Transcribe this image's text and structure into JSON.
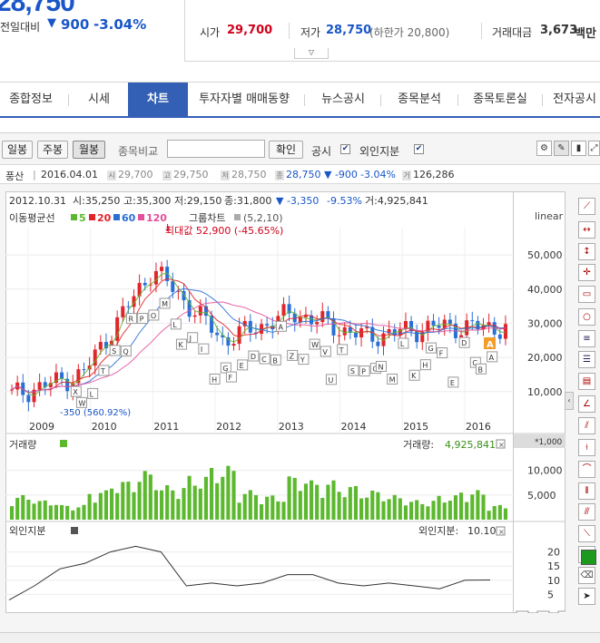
{
  "quote": {
    "price": "28,750",
    "prev_label": "전일대비",
    "prev_arrow": "▼",
    "prev_change": "900",
    "prev_pct": "-3.04%",
    "open_label": "시가",
    "open_value": "29,700",
    "low_label": "저가",
    "low_value": "28,750",
    "low_note": "(하한가 20,800)",
    "amount_label": "거래대금",
    "amount_value": "3,673",
    "amount_unit": "백만",
    "expand_icon": "chevron-down-icon"
  },
  "tabs": [
    {
      "label": "종합정보"
    },
    {
      "label": "시세"
    },
    {
      "label": "차트"
    },
    {
      "label": "투자자별 매매동향"
    },
    {
      "label": "뉴스공시"
    },
    {
      "label": "종목분석"
    },
    {
      "label": "종목토론실"
    },
    {
      "label": "전자공시"
    }
  ],
  "toolbar": {
    "daily": "일봉",
    "weekly": "주봉",
    "monthly": "월봉",
    "compare_label": "종목비교",
    "compare_placeholder": "",
    "confirm": "확인",
    "disclosure_label": "공시",
    "disclosure_checked": "✔",
    "foreign_label": "외인지분",
    "foreign_checked": "✔"
  },
  "info": {
    "name": "풍산",
    "date": "2016.04.01",
    "open_icon": "시",
    "open": "29,700",
    "high_icon": "고",
    "high": "29,750",
    "low_icon": "저",
    "low": "28,750",
    "close_icon": "종",
    "close": "28,750",
    "change": "▼ -900",
    "pct": "-3.04%",
    "vol_icon": "거",
    "volume": "126,286"
  },
  "chart": {
    "header_date": "2012.10.31",
    "header_open": "시:35,250",
    "header_high": "고:35,300",
    "header_low": "저:29,150",
    "header_close": "종:31,800",
    "header_change": "▼ -3,350",
    "header_pct": "-9.53%",
    "header_vol": "거:4,925,841",
    "ma_label": "이동평균선",
    "ma": [
      {
        "name": "5",
        "color": "#5cb82e"
      },
      {
        "name": "20",
        "color": "#e0252b"
      },
      {
        "name": "60",
        "color": "#2a6fd6"
      },
      {
        "name": "120",
        "color": "#e4509c"
      }
    ],
    "group_label": "그룹차트",
    "group_params": "(5,2,10)",
    "scale": "linear",
    "max_note": "최대값 52,900 (-45.65%)",
    "min_note": "-350 (560.92%)",
    "y_ticks": [
      "50,000",
      "40,000",
      "30,000",
      "20,000",
      "10,000"
    ],
    "x_ticks": [
      "2009",
      "2010",
      "2011",
      "2012",
      "2013",
      "2014",
      "2015",
      "2016"
    ],
    "current_badge": "A"
  },
  "volume": {
    "label": "거래량",
    "value_label": "거래량:",
    "value": "4,925,841",
    "unit": "*1,000",
    "y_ticks": [
      "10,000",
      "5,000"
    ],
    "color": "#5cb82e"
  },
  "foreign": {
    "label": "외인지분",
    "value_label": "외인지분:",
    "value": "10.10",
    "y_ticks": [
      "20",
      "15",
      "10",
      "5"
    ]
  },
  "chart_data": [
    {
      "type": "line",
      "title": "",
      "x": [
        "2009",
        "2010",
        "2011",
        "2012",
        "2013",
        "2014",
        "2015",
        "2016"
      ],
      "series": [
        {
          "name": "",
          "values": [
            9000,
            15000,
            46000,
            25000,
            33000,
            26000,
            29000,
            28750
          ]
        }
      ],
      "ylim": [
        0,
        55000
      ],
      "ylabel": "",
      "xlabel": ""
    },
    {
      "type": "bar",
      "title": "거래량",
      "ylim": [
        0,
        14000
      ],
      "values": [
        5000,
        4000,
        3000,
        6000,
        8000,
        10000,
        7000,
        9000,
        11000,
        6000,
        5000,
        9000,
        8000,
        7000,
        6000,
        5000,
        4000,
        5000,
        6000,
        3000
      ]
    },
    {
      "type": "line",
      "title": "외인지분",
      "ylim": [
        0,
        25
      ],
      "values": [
        3,
        8,
        14,
        16,
        20,
        22,
        20,
        8,
        9,
        8,
        9,
        12,
        12,
        9,
        8,
        9,
        8,
        7,
        10,
        10.1
      ]
    }
  ]
}
